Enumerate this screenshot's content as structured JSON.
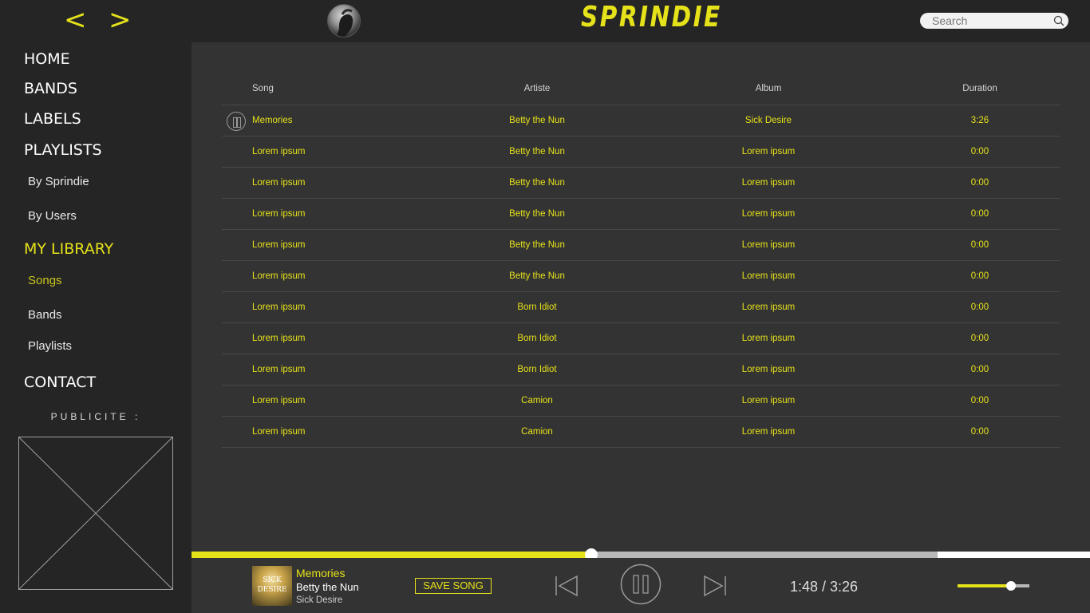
{
  "header": {
    "back_glyph": "<",
    "forward_glyph": ">",
    "brand": "SPRINDIE",
    "search_placeholder": "Search"
  },
  "sidebar": {
    "home": "HOME",
    "bands": "BANDS",
    "labels": "LABELS",
    "playlists": "PLAYLISTS",
    "by_sprindie": "By Sprindie",
    "by_users": "By Users",
    "my_library": "MY LIBRARY",
    "songs": "Songs",
    "lib_bands": "Bands",
    "lib_playlists": "Playlists",
    "contact": "CONTACT",
    "ad_label": "PUBLICITE :"
  },
  "table": {
    "headers": {
      "song": "Song",
      "artist": "Artiste",
      "album": "Album",
      "duration": "Duration"
    },
    "rows": [
      {
        "song": "Memories",
        "artist": "Betty the Nun",
        "album": "Sick Desire",
        "duration": "3:26"
      },
      {
        "song": "Lorem ipsum",
        "artist": "Betty the Nun",
        "album": "Lorem ipsum",
        "duration": "0:00"
      },
      {
        "song": "Lorem ipsum",
        "artist": "Betty the Nun",
        "album": "Lorem ipsum",
        "duration": "0:00"
      },
      {
        "song": "Lorem ipsum",
        "artist": "Betty the Nun",
        "album": "Lorem ipsum",
        "duration": "0:00"
      },
      {
        "song": "Lorem ipsum",
        "artist": "Betty the Nun",
        "album": "Lorem ipsum",
        "duration": "0:00"
      },
      {
        "song": "Lorem ipsum",
        "artist": "Betty the Nun",
        "album": "Lorem ipsum",
        "duration": "0:00"
      },
      {
        "song": "Lorem ipsum",
        "artist": "Born Idiot",
        "album": "Lorem ipsum",
        "duration": "0:00"
      },
      {
        "song": "Lorem ipsum",
        "artist": "Born Idiot",
        "album": "Lorem ipsum",
        "duration": "0:00"
      },
      {
        "song": "Lorem ipsum",
        "artist": "Born Idiot",
        "album": "Lorem ipsum",
        "duration": "0:00"
      },
      {
        "song": "Lorem ipsum",
        "artist": "Camion",
        "album": "Lorem ipsum",
        "duration": "0:00"
      },
      {
        "song": "Lorem ipsum",
        "artist": "Camion",
        "album": "Lorem ipsum",
        "duration": "0:00"
      }
    ]
  },
  "player": {
    "cover_text_1": "SICK",
    "cover_text_2": "DESIRE",
    "title": "Memories",
    "artist": "Betty the Nun",
    "album": "Sick Desire",
    "save_label": "SAVE SONG",
    "time": "1:48 / 3:26",
    "progress_fraction": 0.445,
    "buffered_fraction": 0.83,
    "volume_fraction": 0.74
  },
  "colors": {
    "accent": "#e6e21a",
    "sidebar_bg": "#252525",
    "main_bg": "#333333"
  }
}
